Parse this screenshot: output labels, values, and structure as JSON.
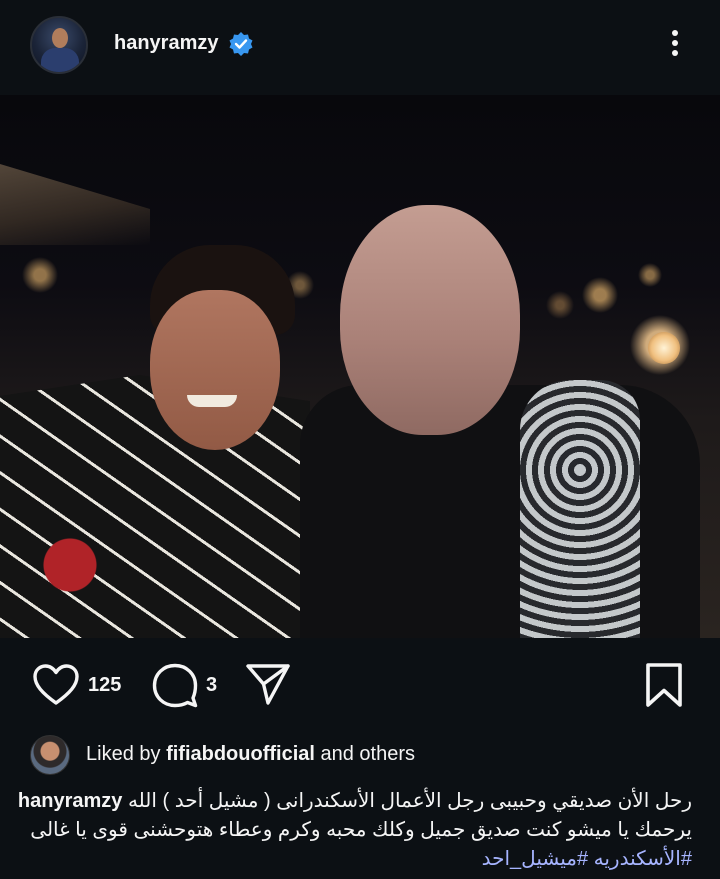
{
  "header": {
    "username": "hanyramzy",
    "verified_icon": "verified-badge-icon",
    "more_icon": "more-vertical-icon"
  },
  "actions": {
    "likes_count": "125",
    "comments_count": "3"
  },
  "liked_by": {
    "prefix": "Liked by ",
    "user": "fifiabdouofficial",
    "suffix": " and others"
  },
  "caption": {
    "username": "hanyramzy",
    "line1": "رحل الأن صديقي وحبيبى رجل الأعمال الأسكندرانى ( مشيل أحد ) الله",
    "line2": "يرحمك يا ميشو كنت صديق جميل وكلك محبه وكرم وعطاء هتوحشنى قوى يا غالى",
    "hashtags": "#الأسكندريه #ميشيل_احد"
  },
  "colors": {
    "background": "#0c1014",
    "text": "#f5f5f5",
    "verified": "#3897f0",
    "hashtag": "#a6b4ff"
  }
}
